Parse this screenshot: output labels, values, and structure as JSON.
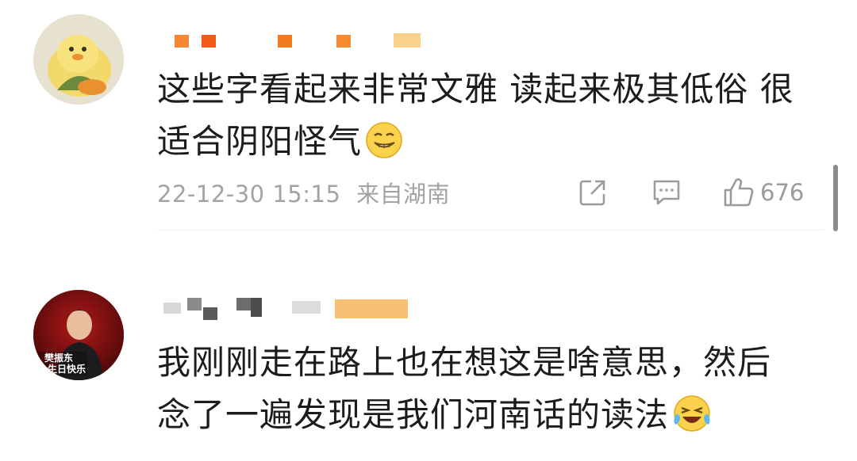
{
  "comments": [
    {
      "text_line1": "这些字看起来非常文雅 读起来极其低俗 很",
      "text_line2": "适合阴阳怪气",
      "emoji": "smirk-emoji",
      "date": "22-12-30 15:15",
      "location": "来自湖南",
      "likes": "676",
      "icons": {
        "share": "share-icon",
        "reply": "comment-icon",
        "like": "thumbs-up-icon"
      }
    },
    {
      "text_line1": "我刚刚走在路上也在想这是啥意思，然后",
      "text_line2": "念了一遍发现是我们河南话的读法",
      "emoji": "laugh-cry-emoji",
      "avatar_text": "樊振东 生日快乐"
    }
  ],
  "colors": {
    "text": "#1c1c1c",
    "meta": "#a3a3a3",
    "username_mask_orange": "#f47a1f",
    "username_mask_grey": "#5a5a5a"
  }
}
